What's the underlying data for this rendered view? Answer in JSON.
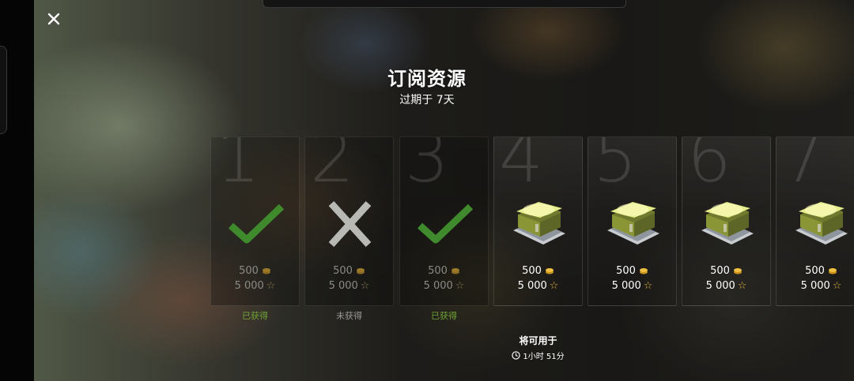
{
  "header": {
    "title": "订阅资源",
    "subtitle": "过期于 7天",
    "close_icon": "close-icon"
  },
  "days": [
    {
      "number": "1",
      "gold": "500",
      "xp": "5 000",
      "state": "received",
      "status": "已获得"
    },
    {
      "number": "2",
      "gold": "500",
      "xp": "5 000",
      "state": "missed",
      "status": "未获得"
    },
    {
      "number": "3",
      "gold": "500",
      "xp": "5 000",
      "state": "received",
      "status": "已获得"
    },
    {
      "number": "4",
      "gold": "500",
      "xp": "5 000",
      "state": "upcoming",
      "status": ""
    },
    {
      "number": "5",
      "gold": "500",
      "xp": "5 000",
      "state": "upcoming",
      "status": ""
    },
    {
      "number": "6",
      "gold": "500",
      "xp": "5 000",
      "state": "upcoming",
      "status": ""
    },
    {
      "number": "7",
      "gold": "500",
      "xp": "5 000",
      "state": "upcoming",
      "status": ""
    }
  ],
  "next_reward": {
    "label": "将可用于",
    "timer": "1小时 51分"
  },
  "colors": {
    "received": "#6fa334",
    "missed": "#9a9a96",
    "star": "#e0b040"
  }
}
